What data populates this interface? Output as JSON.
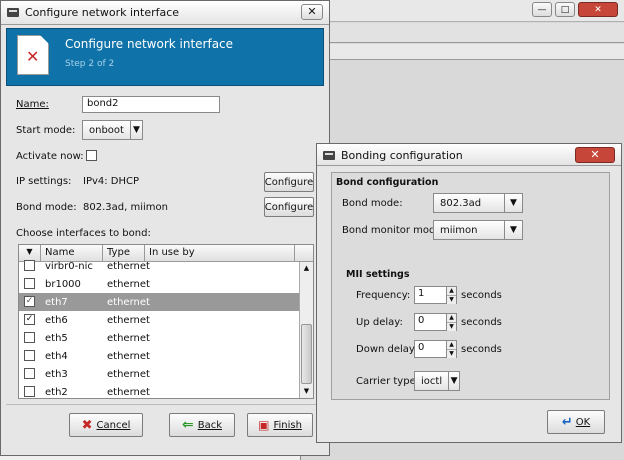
{
  "bg_window": {
    "text1": "",
    "text2": ""
  },
  "main": {
    "title": "Configure network interface",
    "banner_title": "Configure network interface",
    "banner_sub": "Step 2 of 2",
    "name_label": "Name:",
    "name_value": "bond2",
    "start_mode_label": "Start mode:",
    "start_mode_value": "onboot",
    "activate_label": "Activate now:",
    "ip_label": "IP settings:",
    "ip_value": "IPv4: DHCP",
    "bond_mode_label": "Bond mode:",
    "bond_mode_value": "802.3ad, miimon",
    "configure_label": "Configure",
    "choose_label": "Choose interfaces to bond:",
    "columns": [
      "Name",
      "Type",
      "In use by"
    ],
    "rows": [
      {
        "name": "virbr0-nic",
        "type": "ethernet",
        "checked": false,
        "selected": false
      },
      {
        "name": "br1000",
        "type": "ethernet",
        "checked": false,
        "selected": false
      },
      {
        "name": "eth7",
        "type": "ethernet",
        "checked": true,
        "selected": true
      },
      {
        "name": "eth6",
        "type": "ethernet",
        "checked": true,
        "selected": false
      },
      {
        "name": "eth5",
        "type": "ethernet",
        "checked": false,
        "selected": false
      },
      {
        "name": "eth4",
        "type": "ethernet",
        "checked": false,
        "selected": false
      },
      {
        "name": "eth3",
        "type": "ethernet",
        "checked": false,
        "selected": false
      },
      {
        "name": "eth2",
        "type": "ethernet",
        "checked": false,
        "selected": false
      }
    ],
    "cancel_label": "Cancel",
    "back_label": "Back",
    "finish_label": "Finish"
  },
  "bond": {
    "title": "Bonding configuration",
    "section": "Bond configuration",
    "mode_label": "Bond mode:",
    "mode_value": "802.3ad",
    "monitor_label": "Bond monitor mode:",
    "monitor_value": "miimon",
    "mii_label": "MII settings",
    "frequency_label": "Frequency:",
    "frequency_value": "1",
    "updelay_label": "Up delay:",
    "updelay_value": "0",
    "downdelay_label": "Down delay:",
    "downdelay_value": "0",
    "unit": "seconds",
    "carrier_label": "Carrier type:",
    "carrier_value": "ioctl",
    "ok_label": "OK"
  }
}
